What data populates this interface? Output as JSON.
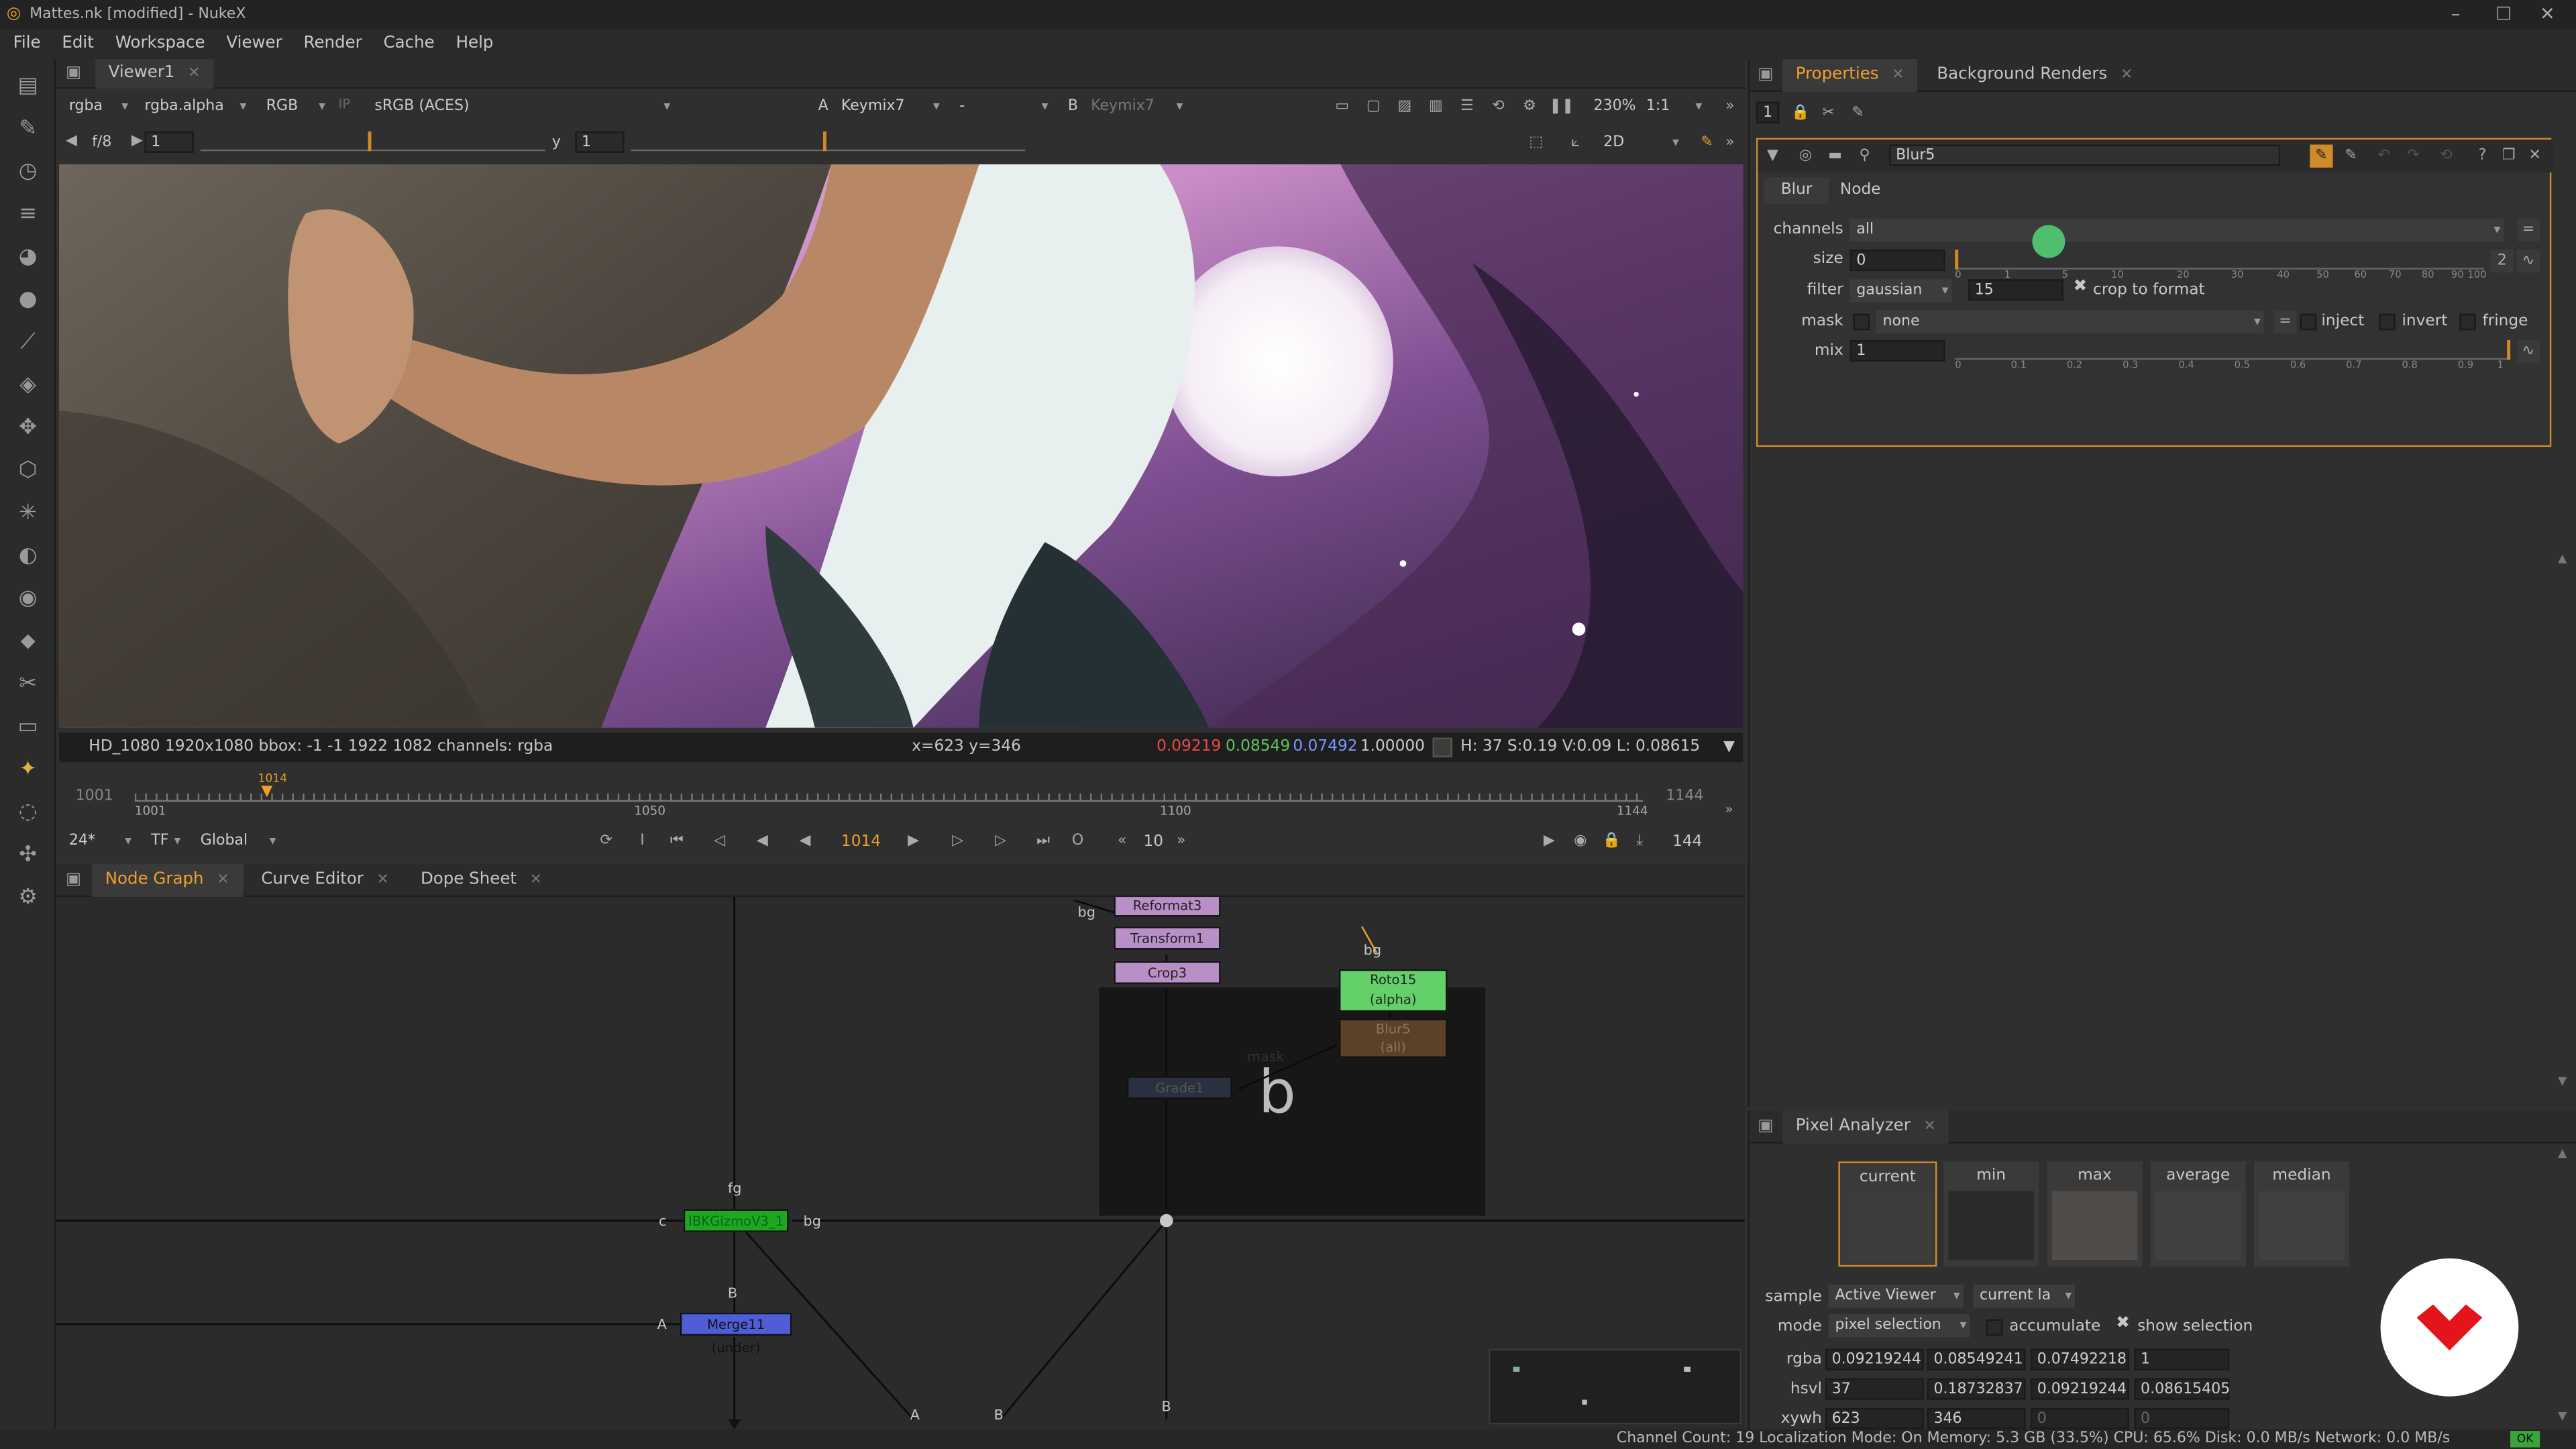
{
  "window": {
    "title": "Mattes.nk [modified] - NukeX",
    "controls": [
      "–",
      "☐",
      "✕"
    ]
  },
  "menu": [
    "File",
    "Edit",
    "Workspace",
    "Viewer",
    "Render",
    "Cache",
    "Help"
  ],
  "viewer": {
    "tab": "Viewer1",
    "channels": "rgba",
    "alpha": "rgba.alpha",
    "rgb": "RGB",
    "ip": "IP",
    "colorspace": "sRGB (ACES)",
    "a_label": "A",
    "a_input": "Keymix7",
    "ab_op": "-",
    "b_label": "B",
    "b_input": "Keymix7",
    "zoom": "230%",
    "ratio": "1:1",
    "fstop": "f/8",
    "gain": "1",
    "y_label": "y",
    "gamma": "1",
    "mode2d": "2D",
    "info_left": "HD_1080 1920x1080  bbox: -1 -1 1922 1082 channels: rgba",
    "info_xy": "x=623 y=346",
    "info_r": "0.09219",
    "info_g": "0.08549",
    "info_b": "0.07492",
    "info_a": "1.00000",
    "info_hsv": "H: 37 S:0.19 V:0.09  L: 0.08615",
    "timeline": {
      "start": "1001",
      "end": "1144",
      "label_1001": "1001",
      "label_1050": "1050",
      "label_1100": "1100",
      "label_1144": "1144",
      "marker": "1014",
      "current_frame": "1014"
    },
    "fps": "24*",
    "tf": "TF",
    "global": "Global",
    "step": "10",
    "frame_count": "144"
  },
  "properties": {
    "tabs": [
      "Properties",
      "Background Renders"
    ],
    "count": "1",
    "node_name": "Blur5",
    "subtabs": [
      "Blur",
      "Node"
    ],
    "channels_label": "channels",
    "channels_value": "all",
    "size_label": "size",
    "size_value": "0",
    "filter_label": "filter",
    "filter_value": "gaussian",
    "filter_quality": "15",
    "crop_label": "crop to format",
    "mask_label": "mask",
    "mask_value": "none",
    "inject": "inject",
    "invert": "invert",
    "fringe": "fringe",
    "mix_label": "mix",
    "mix_value": "1",
    "size_ticks": [
      "0",
      "1",
      "5",
      "10",
      "20",
      "30",
      "40",
      "50",
      "60",
      "70",
      "80",
      "90",
      "100"
    ],
    "mix_ticks": [
      "0",
      "0.1",
      "0.2",
      "0.3",
      "0.4",
      "0.5",
      "0.6",
      "0.7",
      "0.8",
      "0.9",
      "1"
    ],
    "size_dim": "2"
  },
  "nodegraph": {
    "tabs": [
      "Node Graph",
      "Curve Editor",
      "Dope Sheet"
    ],
    "nodes": {
      "reformat": "Reformat3",
      "transform": "Transform1",
      "crop": "Crop3",
      "roto": "Roto15",
      "roto_sub": "(alpha)",
      "blur": "Blur5",
      "blur_sub": "(all)",
      "grade": "Grade1",
      "ibk": "IBKGizmoV3_1",
      "merge": "Merge11 (under)"
    },
    "labels": {
      "bg1": "bg",
      "bg2": "bg",
      "bg3": "bg",
      "fg": "fg",
      "c": "c",
      "b1": "B",
      "a1": "A",
      "a2": "A",
      "b2": "B",
      "b3": "B",
      "mask": "mask",
      "backdrop": "b"
    }
  },
  "pixel_analyzer": {
    "title": "Pixel Analyzer",
    "swatches": [
      "current",
      "min",
      "max",
      "average",
      "median"
    ],
    "sample_label": "sample",
    "sample_value": "Active Viewer",
    "sample_layer": "current la",
    "mode_label": "mode",
    "mode_value": "pixel selection",
    "accumulate": "accumulate",
    "show_selection": "show selection",
    "rows": [
      {
        "label": "rgba",
        "values": [
          "0.09219244",
          "0.08549241",
          "0.07492218",
          "1"
        ]
      },
      {
        "label": "hsvl",
        "values": [
          "37",
          "0.18732837",
          "0.09219244",
          "0.08615405"
        ]
      },
      {
        "label": "xywh",
        "values": [
          "623",
          "346",
          "0",
          "0"
        ]
      }
    ]
  },
  "statusbar": "Channel Count: 19  Localization Mode: On  Memory: 5.3 GB (33.5%)  CPU: 65.6%  Disk: 0.0 MB/s  Network: 0.0 MB/s",
  "status_ok": "OK",
  "colors": {
    "accent": "#f0a02a",
    "logo": "#e3141b",
    "sample_r": "#e84a4a",
    "sample_g": "#5ec45e",
    "sample_b": "#6a8cff"
  }
}
